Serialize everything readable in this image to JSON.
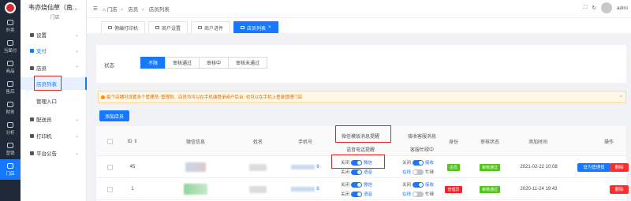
{
  "rail": {
    "items": [
      {
        "label": "外卖",
        "icon": "takeout-icon"
      },
      {
        "label": "当面付",
        "icon": "qr-pay-icon"
      },
      {
        "label": "商品",
        "icon": "goods-icon"
      },
      {
        "label": "售后",
        "icon": "aftersale-icon"
      },
      {
        "label": "财务",
        "icon": "finance-icon"
      },
      {
        "label": "分析",
        "icon": "chart-icon"
      },
      {
        "label": "营销",
        "icon": "marketing-icon"
      },
      {
        "label": "门店",
        "icon": "store-icon"
      }
    ]
  },
  "sidebar": {
    "store_name": "韦亦烧仙草（南...",
    "store_type": "门店",
    "menus": [
      {
        "label": "设置"
      },
      {
        "label": "支付"
      },
      {
        "label": "店员"
      },
      {
        "label": "配送员"
      },
      {
        "label": "打印机"
      },
      {
        "label": "平台公告"
      }
    ],
    "clerk_sub": [
      "店员列表",
      "管理入口"
    ]
  },
  "topbar": {
    "crumbs": [
      "门店",
      "店员",
      "店员列表"
    ],
    "user": "admi"
  },
  "tabs": [
    {
      "label": "佣编打印机"
    },
    {
      "label": "商户设置"
    },
    {
      "label": "商户进件"
    },
    {
      "label": "店员列表",
      "close": "×"
    }
  ],
  "filter": {
    "label": "状态",
    "options": [
      "不限",
      "审核通过",
      "审核中",
      "审核未通过"
    ],
    "selected": "不限"
  },
  "alert": {
    "text": "每个店铺可设置多个管理员; 管理员、店员均可以在手机端登录商户后台; 也可以在手机上登录管理门店",
    "close": "×"
  },
  "add_button": "添加店员",
  "table": {
    "headers": {
      "id": "ID ⇕",
      "wechat": "微信信息",
      "name": "姓名",
      "phone": "手机号",
      "template_msg": "微信模版消息提醒",
      "voice": "语音电话提醒",
      "recv_msg": "接收客服消息",
      "busy": "客服忙碌中",
      "role": "身份",
      "status": "审核状态",
      "added": "添加时间",
      "ops": "操作"
    },
    "rows": [
      {
        "id": "45",
        "phone_suffix": "6",
        "wechat_off": "关闭",
        "wechat_on": "微信",
        "voice_off": "关闭",
        "voice_on": "语音",
        "recv_off": "关闭",
        "recv_on": "接收",
        "busy_off": "在线",
        "busy_on": "忙碌",
        "role": "店员",
        "status": "审核通过",
        "time": "2021-02-22 10:08",
        "btn_admin": "设为管理员",
        "btn_delete": "删除"
      },
      {
        "id": "1",
        "phone_suffix": "6",
        "wechat_off": "关闭",
        "wechat_on": "微信",
        "voice_off": "关闭",
        "voice_on": "语音",
        "recv_off": "关闭",
        "recv_on": "接收",
        "busy_off": "在线",
        "busy_on": "忙碌",
        "role": "管理员",
        "status": "审核通过",
        "time": "2020-11-24 19:43",
        "btn_delete": "删除"
      }
    ]
  },
  "colors": {
    "primary": "#1677ff",
    "rail_bg": "#1f2937",
    "highlight_red": "#e02424",
    "success": "#52c41a",
    "danger": "#f5222d"
  }
}
